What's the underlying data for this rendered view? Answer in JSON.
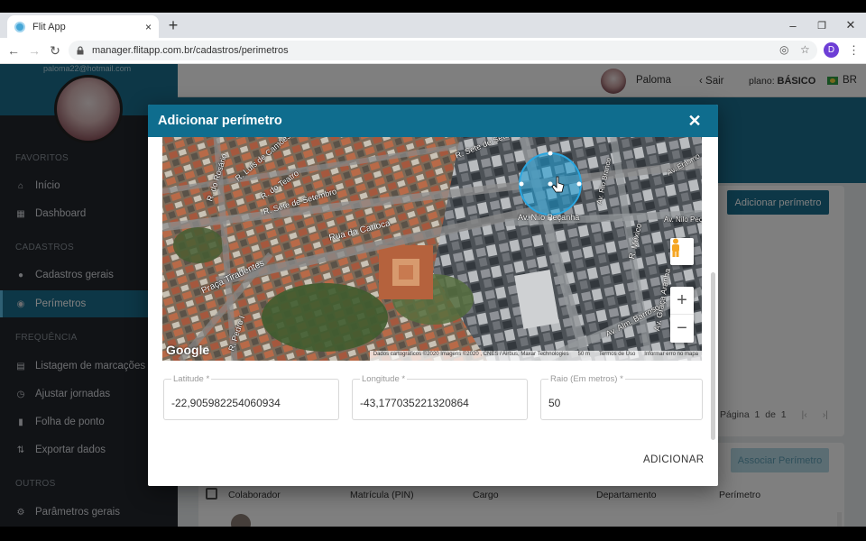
{
  "browser": {
    "tab_title": "Flit App",
    "tab_close": "×",
    "new_tab": "+",
    "url": "manager.flitapp.com.br/cadastros/perimetros",
    "profile_initial": "D",
    "win_min": "–",
    "win_max": "❐",
    "win_close": "✕"
  },
  "sidebar": {
    "email": "paloma22@hotmail.com",
    "sections": {
      "favoritos": "FAVORITOS",
      "cadastros": "CADASTROS",
      "frequencia": "FREQUÊNCIA",
      "outros": "OUTROS"
    },
    "items": [
      {
        "label": "Início",
        "icon": "home-icon"
      },
      {
        "label": "Dashboard",
        "icon": "dashboard-icon"
      },
      {
        "label": "Cadastros gerais",
        "icon": "user-icon"
      },
      {
        "label": "Perímetros",
        "icon": "target-icon",
        "active": true
      },
      {
        "label": "Listagem de marcações",
        "icon": "list-icon"
      },
      {
        "label": "Ajustar jornadas",
        "icon": "clock-icon"
      },
      {
        "label": "Folha de ponto",
        "icon": "sheet-icon"
      },
      {
        "label": "Exportar dados",
        "icon": "export-icon"
      },
      {
        "label": "Parâmetros gerais",
        "icon": "gear-icon"
      }
    ]
  },
  "header": {
    "user_name": "Paloma",
    "logout_label": "Sair",
    "plan_prefix": "plano:",
    "plan_name": "BÁSICO",
    "locale": "BR"
  },
  "page": {
    "add_perimeter_button": "Adicionar perímetro",
    "pager_label": "Página",
    "pager_current": "1",
    "pager_of": "de",
    "pager_total": "1",
    "associate_button": "Associar Perímetro",
    "table_headers": [
      "Colaborador",
      "Matrícula (PIN)",
      "Cargo",
      "Departamento",
      "Perímetro"
    ]
  },
  "modal": {
    "title": "Adicionar perímetro",
    "close_label": "✕",
    "map": {
      "provider_logo": "Google",
      "attribution": "Dados cartográficos ©2020 Imagens ©2020 , CNES / Airbus, Maxar Technologies",
      "scale": "50 m",
      "terms": "Termos de Uso",
      "report": "Informar erro no mapa",
      "zoom_in": "+",
      "zoom_out": "−",
      "streets": {
        "rosario": "R. do Rosário",
        "luis_camoes": "R. Luís de Camões",
        "teatro": "R. do Teatro",
        "sete_setembro_1": "R. Sete de Setembro",
        "sete_setembro_2": "R. Sete de Setembro",
        "carioca": "Rua da Carioca",
        "tiradentes": "Praça Tiradentes",
        "pedro": "R. Pedro I",
        "nilo_pecanha": "Av. Nilo Peçanha",
        "nilo_pecanha_2": "Av. Nilo Peçanha",
        "graca_aranha": "Av. Graça Aranha",
        "almirante_barroso": "Av. Alm. Barroso",
        "mexico": "R. México",
        "erasmo": "Av. Erasmo",
        "rio_branco": "Av. Rio Branco"
      },
      "colors": {
        "circle_fill": "#1c9fd9",
        "circle_stroke": "#2aa6e0"
      }
    },
    "fields": {
      "latitude": {
        "label": "Latitude *",
        "value": "-22,905982254060934"
      },
      "longitude": {
        "label": "Longitude *",
        "value": "-43,177035221320864"
      },
      "radius": {
        "label": "Raio (Em metros) *",
        "value": "50"
      }
    },
    "submit_label": "ADICIONAR"
  },
  "colors": {
    "primary": "#0f6d8e",
    "sidebar_bg": "#23272d",
    "accent_light": "#b7dbe6"
  }
}
